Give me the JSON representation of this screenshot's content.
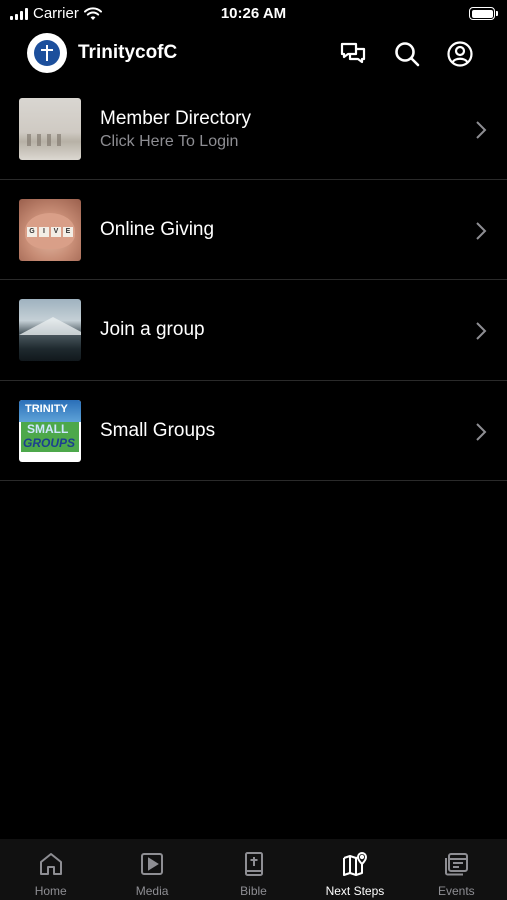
{
  "status_bar": {
    "carrier": "Carrier",
    "time": "10:26 AM"
  },
  "header": {
    "title": "TrinitycofC",
    "icons": [
      "chat-icon",
      "search-icon",
      "profile-icon"
    ]
  },
  "items": [
    {
      "title": "Member Directory",
      "subtitle": "Click Here To Login",
      "thumbnail": "member-directory-thumbnail"
    },
    {
      "title": "Online Giving",
      "subtitle": "",
      "thumbnail": "online-giving-thumbnail"
    },
    {
      "title": "Join a group",
      "subtitle": "",
      "thumbnail": "join-group-thumbnail"
    },
    {
      "title": "Small Groups",
      "subtitle": "",
      "thumbnail": "small-groups-thumbnail"
    }
  ],
  "giving_tiles": [
    "G",
    "I",
    "V",
    "E"
  ],
  "small_groups_logo": {
    "line1": "TRINITY",
    "line2": "SMALL",
    "line3": "GROUPS"
  },
  "tabs": [
    {
      "label": "Home",
      "icon": "home-icon",
      "active": false
    },
    {
      "label": "Media",
      "icon": "media-icon",
      "active": false
    },
    {
      "label": "Bible",
      "icon": "bible-icon",
      "active": false
    },
    {
      "label": "Next Steps",
      "icon": "map-icon",
      "active": true
    },
    {
      "label": "Events",
      "icon": "events-icon",
      "active": false
    }
  ],
  "colors": {
    "background": "#000000",
    "secondary_text": "#8e8e93",
    "divider": "#2a2a2a"
  }
}
